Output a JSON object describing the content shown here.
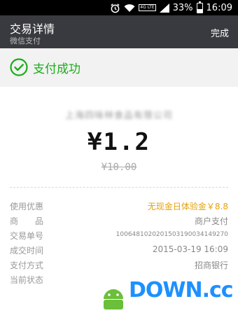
{
  "status_bar": {
    "lte_label": "4G LTE",
    "battery_percent": "33%",
    "battery_level": 0.33,
    "time": "16:09"
  },
  "header": {
    "title": "交易详情",
    "subtitle": "微信支付",
    "done_label": "完成"
  },
  "success": {
    "text": "支付成功",
    "color": "#1aad19"
  },
  "payment": {
    "merchant": "上海四味林食品有限公司",
    "amount": "¥1.2",
    "original_amount": "¥10.00"
  },
  "details": [
    {
      "label": "使用优惠",
      "value": "无现金日体验金￥8.8"
    },
    {
      "label": "商　　品",
      "value": "商户支付"
    },
    {
      "label": "交易单号",
      "value": "1006481020201503190034149270"
    },
    {
      "label": "成交时间",
      "value": "2015-03-19 16:09"
    },
    {
      "label": "支付方式",
      "value": "招商银行"
    },
    {
      "label": "当前状态",
      "value": ""
    }
  ],
  "watermark": {
    "text": "DOWN.cc"
  },
  "colors": {
    "title_bar": "#393a3f",
    "accent_green": "#1aad19",
    "discount_orange": "#e3a10b"
  },
  "icons": [
    "alarm-icon",
    "wifi-icon",
    "signal-icon",
    "battery-icon",
    "check-circle-icon"
  ]
}
